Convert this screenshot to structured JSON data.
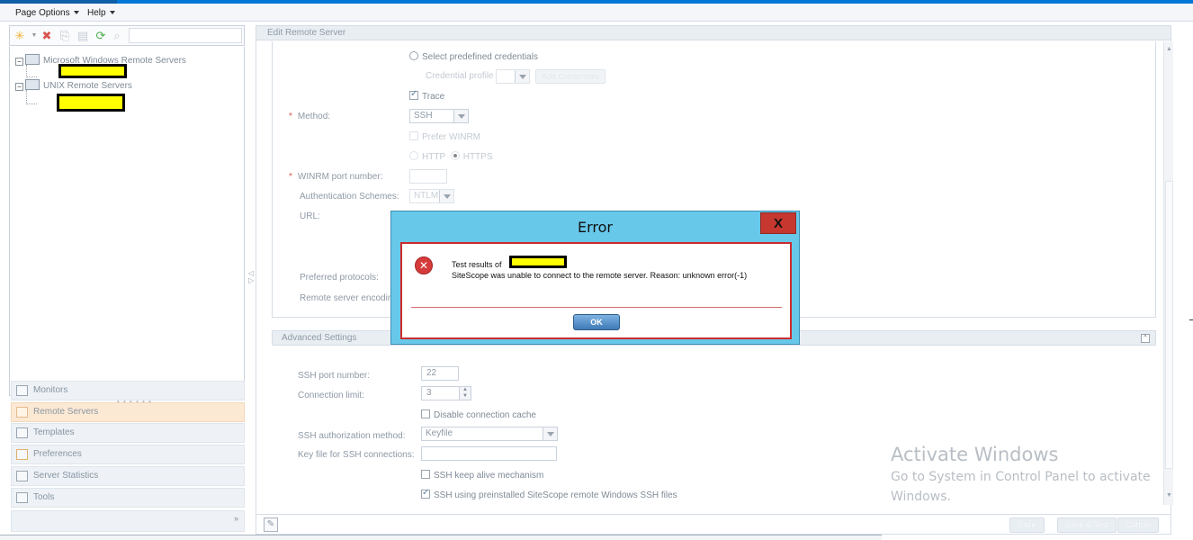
{
  "menu": {
    "page_options": "Page Options",
    "help": "Help"
  },
  "tree": {
    "nodes": [
      {
        "label": "Microsoft Windows Remote Servers"
      },
      {
        "label": "UNIX Remote Servers"
      }
    ]
  },
  "nav": {
    "items": [
      {
        "label": "Monitors"
      },
      {
        "label": "Remote Servers"
      },
      {
        "label": "Templates"
      },
      {
        "label": "Preferences"
      },
      {
        "label": "Server Statistics"
      },
      {
        "label": "Tools"
      }
    ]
  },
  "panel": {
    "title": "Edit Remote Server"
  },
  "form": {
    "select_predefined": "Select predefined credentials",
    "credential_profile": "Credential profile",
    "add_credentials": "Add Credentials",
    "trace": "Trace",
    "method_label": "Method:",
    "method_value": "SSH",
    "prefer_winrm": "Prefer WINRM",
    "http": "HTTP",
    "https": "HTTPS",
    "winrm_port_label": "WINRM port number:",
    "auth_schemes_label": "Authentication Schemes:",
    "auth_schemes_value": "NTLM",
    "url_label": "URL:",
    "preferred_protocols_label": "Preferred protocols:",
    "encoding_label": "Remote server encodin"
  },
  "advanced": {
    "title": "Advanced Settings",
    "ssh_port_label": "SSH port number:",
    "ssh_port_value": "22",
    "conn_limit_label": "Connection limit:",
    "conn_limit_value": "3",
    "disable_cache": "Disable connection cache",
    "ssh_auth_label": "SSH authorization method:",
    "ssh_auth_value": "Keyfile",
    "key_file_label": "Key file for SSH connections:",
    "keep_alive": "SSH keep alive mechanism",
    "preinstalled": "SSH using preinstalled SiteScope remote Windows SSH files"
  },
  "footer": {
    "save": "Save",
    "save_test": "Save & Test",
    "cancel": "Cancel"
  },
  "watermark": {
    "title": "Activate Windows",
    "line1": "Go to System in Control Panel to activate",
    "line2": "Windows."
  },
  "dialog": {
    "title": "Error",
    "close": "X",
    "line1": "Test results of",
    "line2": "SiteScope was unable to connect to the remote server. Reason: unknown error(-1)",
    "ok": "OK"
  }
}
